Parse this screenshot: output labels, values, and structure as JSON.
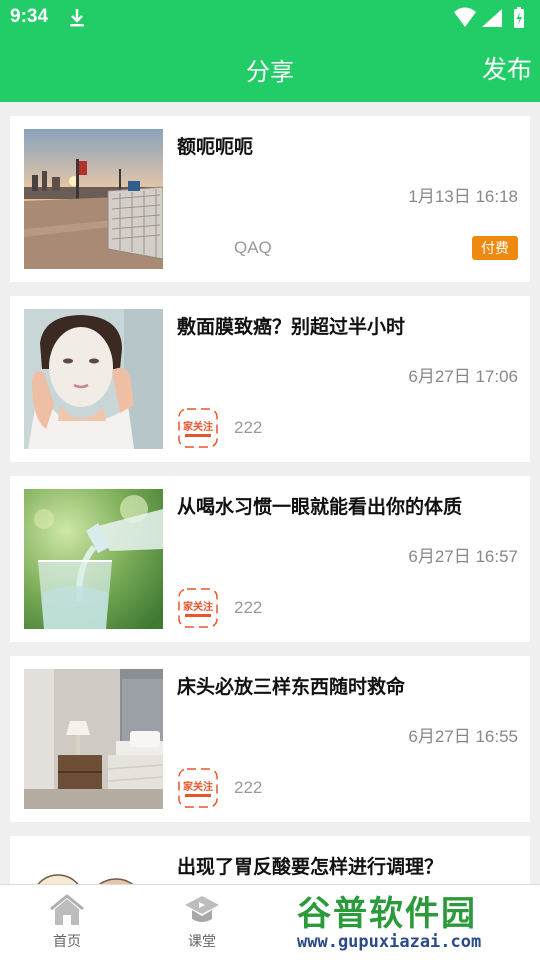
{
  "statusbar": {
    "time": "9:34"
  },
  "header": {
    "title": "分享",
    "publish_label": "发布"
  },
  "feed": [
    {
      "title": "额呃呃呃",
      "time": "1月13日 16:18",
      "author": "QAQ",
      "badge": "付费",
      "thumb_icon": "sunset-plaza-photo"
    },
    {
      "title": "敷面膜致癌？别超过半小时",
      "time": "6月27日 17:06",
      "author": "222",
      "thumb_icon": "face-mask-photo"
    },
    {
      "title": "从喝水习惯一眼就能看出你的体质",
      "time": "6月27日 16:57",
      "author": "222",
      "thumb_icon": "water-glass-photo"
    },
    {
      "title": "床头必放三样东西随时救命",
      "time": "6月27日 16:55",
      "author": "222",
      "thumb_icon": "bedroom-photo"
    },
    {
      "title": "出现了胃反酸要怎样进行调理？",
      "thumb_icon": "cartoon-photo"
    }
  ],
  "avatar_text": "家关注",
  "tabbar": {
    "items": [
      {
        "label": "首页",
        "icon": "home-icon"
      },
      {
        "label": "课堂",
        "icon": "graduation-cap-icon"
      }
    ]
  },
  "watermark": {
    "title": "谷普软件园",
    "url": "www.gupuxiazai.com"
  },
  "colors": {
    "primary": "#22cd68",
    "badge": "#ef8a10",
    "logo": "#e8552b"
  }
}
